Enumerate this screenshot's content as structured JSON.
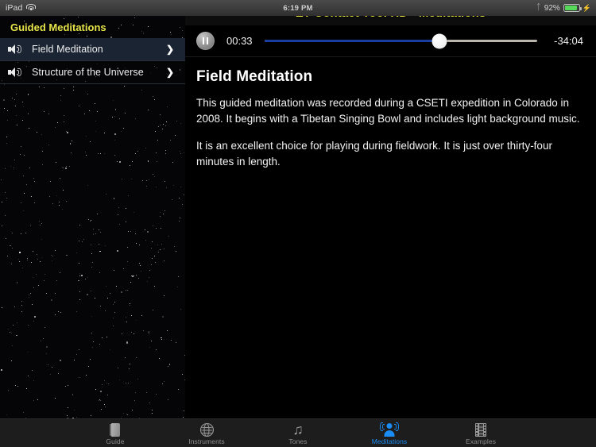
{
  "statusbar": {
    "device": "iPad",
    "wifi_icon": "wifi-icon",
    "time": "6:19 PM",
    "bluetooth_icon": "bluetooth-icon",
    "battery_percent": "92%",
    "battery_icon": "battery-icon",
    "charging_icon": "charging-bolt-icon"
  },
  "titlebar": {
    "title": "ET Contact Tool HD - Meditations",
    "title_color": "#f2ef3f"
  },
  "sidebar": {
    "header": "Guided Meditations",
    "header_color": "#e6e44a",
    "selected_color": "#1b2433",
    "items": [
      {
        "label": "Field Meditation",
        "icon": "speaker-icon",
        "chevron": "❯",
        "selected": true
      },
      {
        "label": "Structure of the Universe",
        "icon": "speaker-icon",
        "chevron": "❯",
        "selected": false
      }
    ]
  },
  "player": {
    "transport_icon": "pause-icon",
    "elapsed": "00:33",
    "remaining": "-34:04",
    "progress_percent": 64,
    "fill_color": "#1a3da0",
    "track_color": "#b9b5ad"
  },
  "article": {
    "heading": "Field Meditation",
    "paragraph1": "This guided meditation was recorded during a CSETI expedition in Colorado in 2008. It begins with a Tibetan Singing Bowl and includes light background music.",
    "paragraph2": "It is an excellent choice for playing during fieldwork. It is just over thirty-four minutes in length."
  },
  "tabbar": {
    "active_color": "#1b8cf5",
    "inactive_color": "#8d8d8d",
    "tabs": [
      {
        "label": "Guide",
        "icon": "book-icon",
        "active": false
      },
      {
        "label": "Instruments",
        "icon": "globe-radar-icon",
        "active": false
      },
      {
        "label": "Tones",
        "icon": "music-note-icon",
        "active": false
      },
      {
        "label": "Meditations",
        "icon": "person-sound-waves-icon",
        "active": true
      },
      {
        "label": "Examples",
        "icon": "film-strip-icon",
        "active": false
      }
    ]
  }
}
